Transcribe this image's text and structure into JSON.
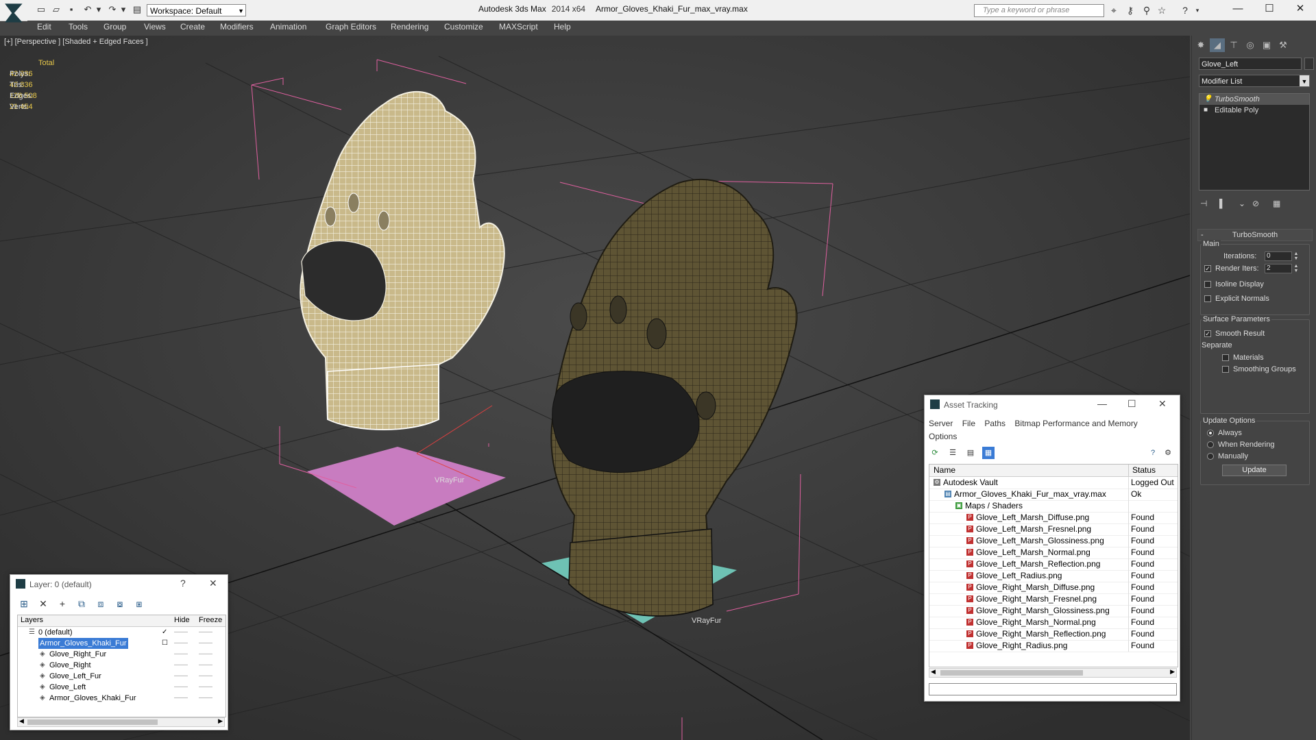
{
  "titlebar": {
    "workspace": "Workspace: Default",
    "app_title": "Autodesk 3ds Max",
    "app_version": "2014 x64",
    "doc_title": "Armor_Gloves_Khaki_Fur_max_vray.max",
    "search_placeholder": "Type a keyword or phrase"
  },
  "menubar": [
    "Edit",
    "Tools",
    "Group",
    "Views",
    "Create",
    "Modifiers",
    "Animation",
    "Graph Editors",
    "Rendering",
    "Customize",
    "MAXScript",
    "Help"
  ],
  "viewport": {
    "label": "[+] [Perspective ] [Shaded + Edged Faces ]",
    "stats": {
      "header": "Total",
      "rows": [
        {
          "label": "Polys:",
          "value": "42 836"
        },
        {
          "label": "Tris:",
          "value": "42 836"
        },
        {
          "label": "Edges:",
          "value": "128 508"
        },
        {
          "label": "Verts:",
          "value": "21 454"
        }
      ]
    },
    "vrayfur_labels": [
      "VRayFur",
      "VRayFur"
    ]
  },
  "command_panel": {
    "object_name": "Glove_Left",
    "modifier_list": "Modifier List",
    "stack": [
      "TurboSmooth",
      "Editable Poly"
    ],
    "turbosmooth": {
      "title": "TurboSmooth",
      "main_label": "Main",
      "iterations_label": "Iterations:",
      "iterations_value": "0",
      "render_iters_label": "Render Iters:",
      "render_iters_value": "2",
      "isoline_label": "Isoline Display",
      "explicit_normals_label": "Explicit Normals",
      "surface_label": "Surface Parameters",
      "smooth_result_label": "Smooth Result",
      "separate_label": "Separate",
      "materials_label": "Materials",
      "smoothing_groups_label": "Smoothing Groups",
      "update_options_label": "Update Options",
      "always_label": "Always",
      "when_rendering_label": "When Rendering",
      "manually_label": "Manually",
      "update_button": "Update"
    }
  },
  "asset_tracking": {
    "title": "Asset Tracking",
    "menu": [
      "Server",
      "File",
      "Paths",
      "Bitmap Performance and Memory"
    ],
    "menu2": "Options",
    "col_name": "Name",
    "col_status": "Status",
    "rows": [
      {
        "name": "Autodesk Vault",
        "status": "Logged Out",
        "level": 0,
        "icon": "vault"
      },
      {
        "name": "Armor_Gloves_Khaki_Fur_max_vray.max",
        "status": "Ok",
        "level": 1,
        "icon": "max"
      },
      {
        "name": "Maps / Shaders",
        "status": "",
        "level": 2,
        "icon": "maps"
      },
      {
        "name": "Glove_Left_Marsh_Diffuse.png",
        "status": "Found",
        "level": 3,
        "icon": "png"
      },
      {
        "name": "Glove_Left_Marsh_Fresnel.png",
        "status": "Found",
        "level": 3,
        "icon": "png"
      },
      {
        "name": "Glove_Left_Marsh_Glossiness.png",
        "status": "Found",
        "level": 3,
        "icon": "png"
      },
      {
        "name": "Glove_Left_Marsh_Normal.png",
        "status": "Found",
        "level": 3,
        "icon": "png"
      },
      {
        "name": "Glove_Left_Marsh_Reflection.png",
        "status": "Found",
        "level": 3,
        "icon": "png"
      },
      {
        "name": "Glove_Left_Radius.png",
        "status": "Found",
        "level": 3,
        "icon": "png"
      },
      {
        "name": "Glove_Right_Marsh_Diffuse.png",
        "status": "Found",
        "level": 3,
        "icon": "png"
      },
      {
        "name": "Glove_Right_Marsh_Fresnel.png",
        "status": "Found",
        "level": 3,
        "icon": "png"
      },
      {
        "name": "Glove_Right_Marsh_Glossiness.png",
        "status": "Found",
        "level": 3,
        "icon": "png"
      },
      {
        "name": "Glove_Right_Marsh_Normal.png",
        "status": "Found",
        "level": 3,
        "icon": "png"
      },
      {
        "name": "Glove_Right_Marsh_Reflection.png",
        "status": "Found",
        "level": 3,
        "icon": "png"
      },
      {
        "name": "Glove_Right_Radius.png",
        "status": "Found",
        "level": 3,
        "icon": "png"
      }
    ]
  },
  "layer_window": {
    "title": "Layer: 0 (default)",
    "col_layers": "Layers",
    "col_hide": "Hide",
    "col_freeze": "Freeze",
    "rows": [
      {
        "name": "0 (default)",
        "level": 0,
        "selected": false,
        "active": true
      },
      {
        "name": "Armor_Gloves_Khaki_Fur",
        "level": 0,
        "selected": true,
        "active": false
      },
      {
        "name": "Glove_Right_Fur",
        "level": 1,
        "selected": false,
        "active": false
      },
      {
        "name": "Glove_Right",
        "level": 1,
        "selected": false,
        "active": false
      },
      {
        "name": "Glove_Left_Fur",
        "level": 1,
        "selected": false,
        "active": false
      },
      {
        "name": "Glove_Left",
        "level": 1,
        "selected": false,
        "active": false
      },
      {
        "name": "Armor_Gloves_Khaki_Fur",
        "level": 1,
        "selected": false,
        "active": false
      }
    ]
  },
  "colors": {
    "stats": "#e8c84a",
    "selection": "#3a7bd5",
    "pink_plane": "#c87cc0",
    "teal_plane": "#6ec2b4",
    "bbox": "#e060a0"
  }
}
